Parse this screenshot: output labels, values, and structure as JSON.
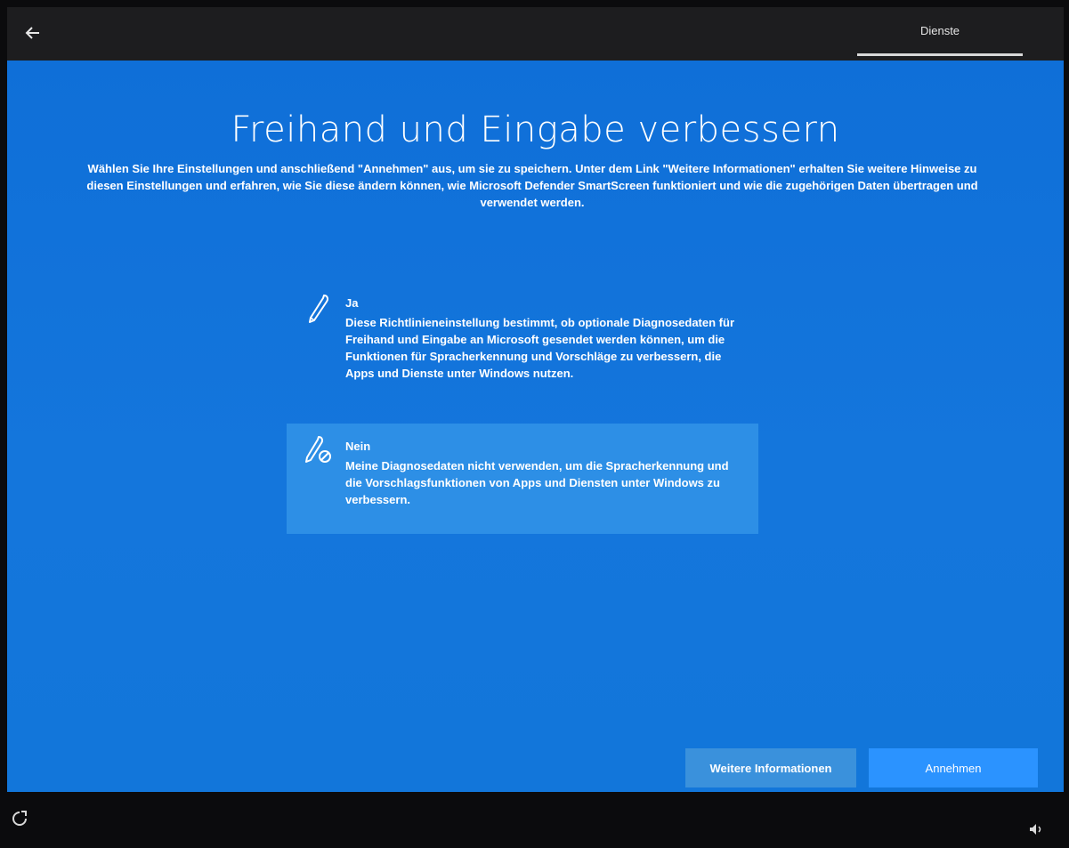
{
  "header": {
    "back_icon": "arrow-left-icon",
    "tab_label": "Dienste"
  },
  "main": {
    "title": "Freihand und Eingabe verbessern",
    "subtitle": "Wählen Sie Ihre Einstellungen und anschließend \"Annehmen\" aus, um sie zu speichern. Unter dem Link \"Weitere Informationen\" erhalten Sie weitere Hinweise zu diesen Einstellungen und erfahren, wie Sie diese ändern können, wie Microsoft Defender SmartScreen funktioniert und wie die zugehörigen Daten übertragen und verwendet werden.",
    "options": [
      {
        "title": "Ja",
        "description": "Diese Richtlinieneinstellung bestimmt, ob optionale Diagnosedaten für Freihand und Eingabe an Microsoft gesendet werden können, um die Funktionen für Spracherkennung und Vorschläge zu verbessern, die Apps und Dienste unter Windows nutzen.",
        "icon": "pen-icon",
        "selected": false
      },
      {
        "title": "Nein",
        "description": "Meine Diagnosedaten nicht verwenden, um die Spracherkennung und die Vorschlagsfunktionen von Apps und Diensten unter Windows zu verbessern.",
        "icon": "pen-blocked-icon",
        "selected": true
      }
    ]
  },
  "footer": {
    "more_info_label": "Weitere Informationen",
    "accept_label": "Annehmen",
    "accessibility_icon": "ease-of-access-icon",
    "volume_icon": "speaker-icon"
  },
  "colors": {
    "background": "#1473d8",
    "selected_option": "#2d8fe6",
    "accept_button": "#2b93ff",
    "info_button": "#3a91dc"
  }
}
